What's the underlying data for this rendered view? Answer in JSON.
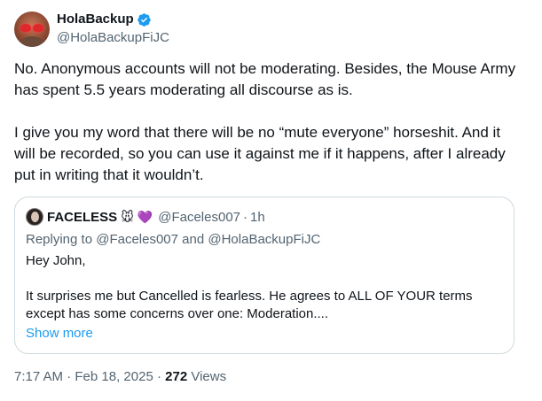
{
  "author": {
    "display_name": "HolaBackup",
    "handle": "@HolaBackupFiJC",
    "verified_icon": "verified-badge-icon"
  },
  "tweet": {
    "paragraph_1": "No. Anonymous accounts will not be moderating. Besides, the Mouse Army has spent 5.5 years moderating all discourse as is.",
    "paragraph_2": "I give you my word that there will be no “mute everyone” horseshit. And it will be recorded, so you can use it against me if it happens, after I already put in writing that it wouldn’t."
  },
  "quote": {
    "display_name": "FACELESS",
    "emoji_1": "🐭",
    "emoji_2": "💜",
    "handle": "@Faceles007",
    "separator": "·",
    "time": "1h",
    "replying_prefix": "Replying to",
    "replying_to_1": "@Faceles007",
    "replying_and": "and",
    "replying_to_2": "@HolaBackupFiJC",
    "body_line_1": "Hey John,",
    "body_line_2": "It surprises me but Cancelled is fearless. He agrees to ALL OF YOUR terms except has some concerns over one: Moderation....",
    "show_more": "Show more"
  },
  "meta": {
    "time": "7:17 AM",
    "dot_1": "·",
    "date": "Feb 18, 2025",
    "dot_2": "·",
    "views_count": "272",
    "views_label": "Views"
  },
  "colors": {
    "text": "#0f1419",
    "secondary": "#536471",
    "link": "#1d9bf0",
    "border": "#cfd9de"
  }
}
